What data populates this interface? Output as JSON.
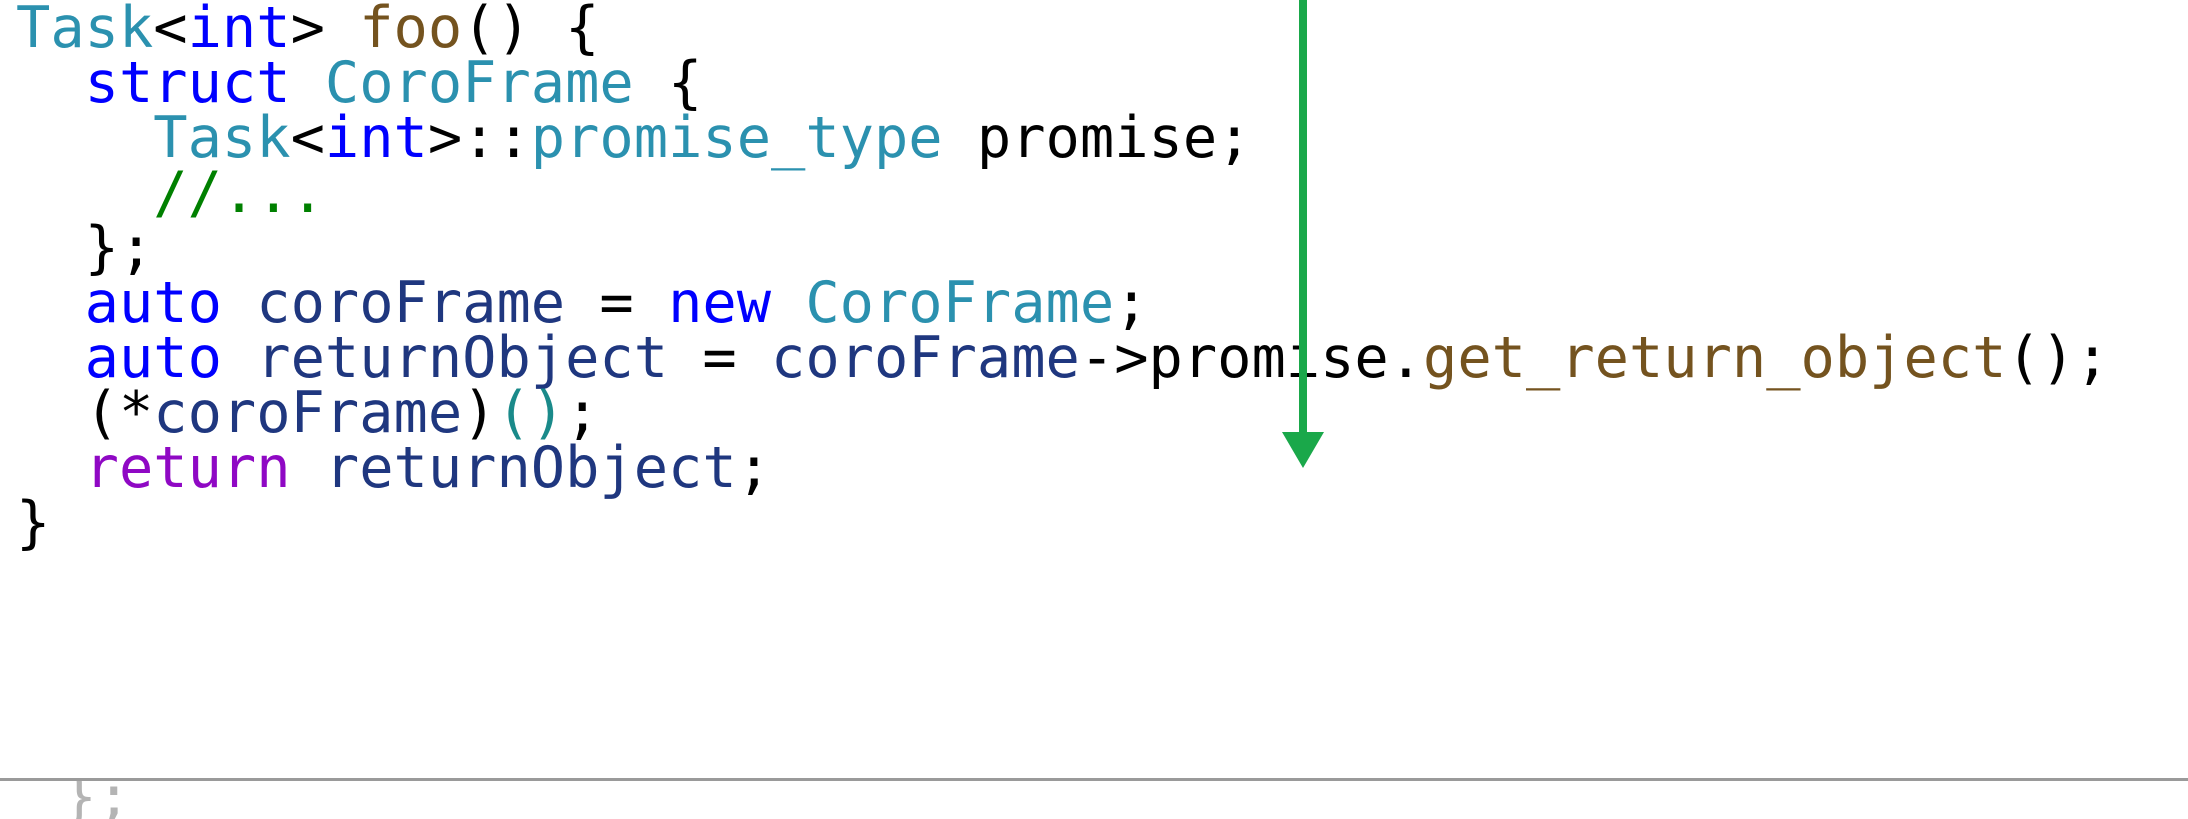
{
  "colors": {
    "type": "#2b91af",
    "keyword": "#0000ff",
    "function": "#74531f",
    "variable": "#1f377f",
    "comment": "#008000",
    "control": "#8f08c4",
    "plain": "#000000",
    "call_parens": "#1a8a8a",
    "arrow": "#1aa84a",
    "faded": "#b4b4b4"
  },
  "code": {
    "lines": [
      {
        "tokens": [
          {
            "text": "Task",
            "kind": "type"
          },
          {
            "text": "<",
            "kind": "plain"
          },
          {
            "text": "int",
            "kind": "keyword"
          },
          {
            "text": "> ",
            "kind": "plain"
          },
          {
            "text": "foo",
            "kind": "function"
          },
          {
            "text": "() {",
            "kind": "plain"
          }
        ]
      },
      {
        "tokens": [
          {
            "text": "  ",
            "kind": "plain"
          },
          {
            "text": "struct",
            "kind": "keyword"
          },
          {
            "text": " ",
            "kind": "plain"
          },
          {
            "text": "CoroFrame",
            "kind": "type"
          },
          {
            "text": " {",
            "kind": "plain"
          }
        ]
      },
      {
        "tokens": [
          {
            "text": "    ",
            "kind": "plain"
          },
          {
            "text": "Task",
            "kind": "type"
          },
          {
            "text": "<",
            "kind": "plain"
          },
          {
            "text": "int",
            "kind": "keyword"
          },
          {
            "text": ">::",
            "kind": "plain"
          },
          {
            "text": "promise_type",
            "kind": "type"
          },
          {
            "text": " promise;",
            "kind": "plain"
          }
        ]
      },
      {
        "tokens": [
          {
            "text": "    ",
            "kind": "plain"
          },
          {
            "text": "//...",
            "kind": "comment"
          }
        ]
      },
      {
        "tokens": [
          {
            "text": "  };",
            "kind": "plain"
          }
        ]
      },
      {
        "tokens": [
          {
            "text": "  ",
            "kind": "plain"
          },
          {
            "text": "auto",
            "kind": "keyword"
          },
          {
            "text": " ",
            "kind": "plain"
          },
          {
            "text": "coroFrame",
            "kind": "variable"
          },
          {
            "text": " = ",
            "kind": "plain"
          },
          {
            "text": "new",
            "kind": "keyword"
          },
          {
            "text": " ",
            "kind": "plain"
          },
          {
            "text": "CoroFrame",
            "kind": "type"
          },
          {
            "text": ";",
            "kind": "plain"
          }
        ]
      },
      {
        "tokens": [
          {
            "text": "  ",
            "kind": "plain"
          },
          {
            "text": "auto",
            "kind": "keyword"
          },
          {
            "text": " ",
            "kind": "plain"
          },
          {
            "text": "returnObject",
            "kind": "variable"
          },
          {
            "text": " = ",
            "kind": "plain"
          },
          {
            "text": "coroFrame",
            "kind": "variable"
          },
          {
            "text": "->promise.",
            "kind": "plain"
          },
          {
            "text": "get_return_object",
            "kind": "function"
          },
          {
            "text": "();",
            "kind": "plain"
          }
        ]
      },
      {
        "tokens": [
          {
            "text": "  (*",
            "kind": "plain"
          },
          {
            "text": "coroFrame",
            "kind": "variable"
          },
          {
            "text": ")",
            "kind": "plain"
          },
          {
            "text": "()",
            "kind": "call_parens"
          },
          {
            "text": ";",
            "kind": "plain"
          }
        ]
      },
      {
        "tokens": [
          {
            "text": "  ",
            "kind": "plain"
          },
          {
            "text": "return",
            "kind": "control"
          },
          {
            "text": " ",
            "kind": "plain"
          },
          {
            "text": "returnObject",
            "kind": "variable"
          },
          {
            "text": ";",
            "kind": "plain"
          }
        ]
      },
      {
        "tokens": [
          {
            "text": "}",
            "kind": "plain"
          }
        ]
      }
    ],
    "below_separator_text": " };"
  },
  "annotation": {
    "icon": "down-arrow-icon",
    "color": "#1aa84a"
  }
}
